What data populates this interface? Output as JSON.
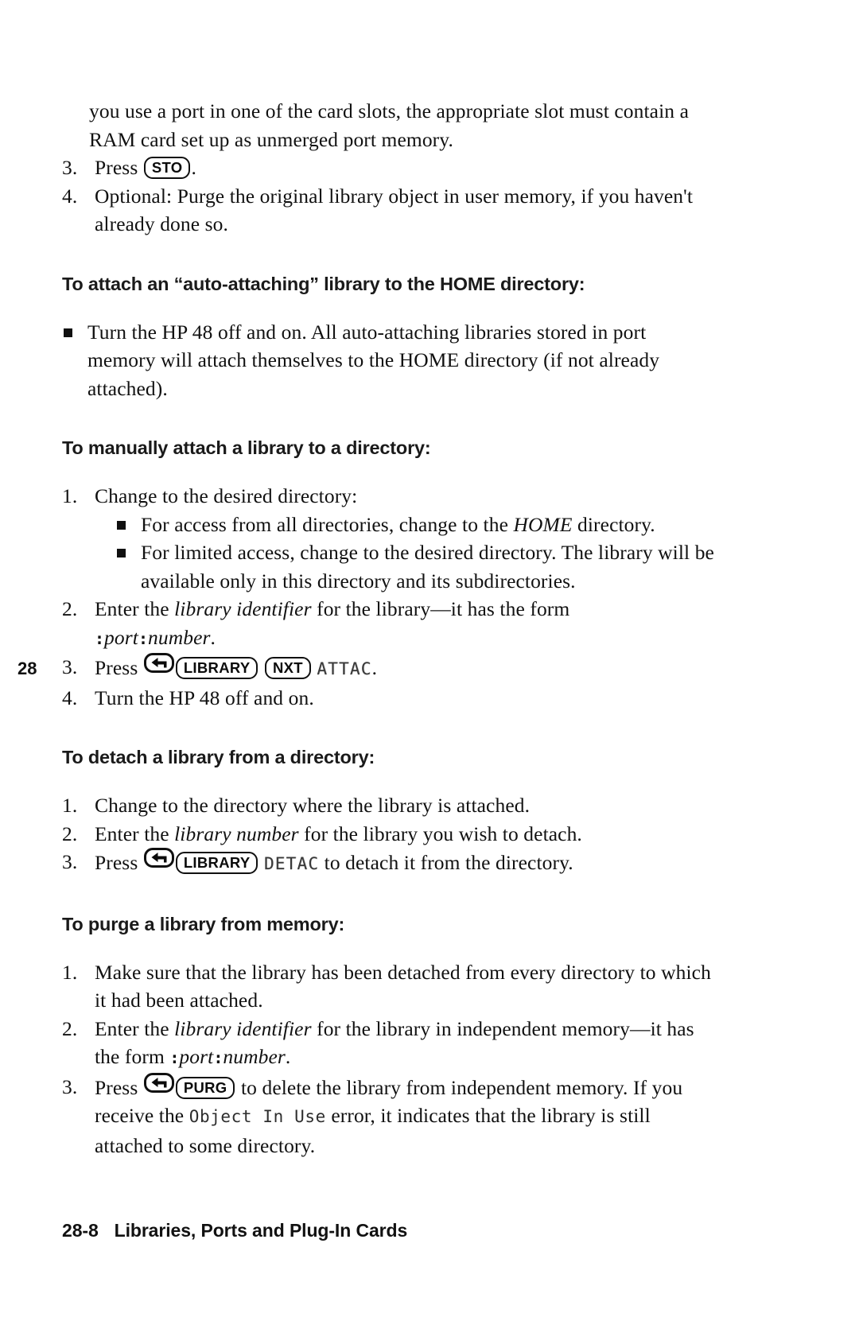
{
  "page": {
    "margin_tab": "28",
    "footer_page_number": "28-8",
    "footer_title": "Libraries, Ports and Plug-In Cards"
  },
  "intro": {
    "continued_text": "you use a port in one of the card slots, the appropriate slot must contain a RAM card set up as unmerged port memory.",
    "steps": [
      {
        "number": "3.",
        "lead": "Press",
        "key": "STO",
        "trail": "."
      },
      {
        "number": "4.",
        "text": "Optional: Purge the original library object in user memory, if you haven't already done so."
      }
    ]
  },
  "sections": [
    {
      "heading": "To attach an “auto-attaching” library to the HOME directory:",
      "bullets": [
        "Turn the HP 48 off and on. All auto-attaching libraries stored in port memory will attach themselves to the HOME directory (if not already attached)."
      ]
    },
    {
      "heading": "To manually attach a library to a directory:",
      "steps": [
        {
          "number": "1.",
          "text": "Change to the desired directory:",
          "subbullets": [
            {
              "pre": "For access from all directories, change to the ",
              "italic": "HOME",
              "post": " directory."
            },
            {
              "pre": "For limited access, change to the desired directory. The library will be available only in this directory and its subdirectories.",
              "italic": "",
              "post": ""
            }
          ]
        },
        {
          "number": "2.",
          "pre": "Enter the ",
          "italic": "library identifier",
          "post": " for the library—it has the form",
          "form_prefix": ":",
          "form_port": "port",
          "form_colon": ":",
          "form_number": "number",
          "form_suffix": "."
        },
        {
          "number": "3.",
          "lead": "Press",
          "keys": [
            "shift-left",
            "LIBRARY",
            "NXT"
          ],
          "menu_label": "ATTAC",
          "trail": "."
        },
        {
          "number": "4.",
          "text": "Turn the HP 48 off and on."
        }
      ]
    },
    {
      "heading": "To detach a library from a directory:",
      "steps": [
        {
          "number": "1.",
          "text": "Change to the directory where the library is attached."
        },
        {
          "number": "2.",
          "pre": "Enter the ",
          "italic": "library number",
          "post": " for the library you wish to detach."
        },
        {
          "number": "3.",
          "lead": "Press",
          "keys": [
            "shift-left",
            "LIBRARY"
          ],
          "menu_label": "DETAC",
          "trail": " to detach it from the directory."
        }
      ]
    },
    {
      "heading": "To purge a library from memory:",
      "steps": [
        {
          "number": "1.",
          "text": "Make sure that the library has been detached from every directory to which it had been attached."
        },
        {
          "number": "2.",
          "pre": "Enter the ",
          "italic": "library identifier",
          "post": " for the library in independent memory—it has the form ",
          "form_prefix": ":",
          "form_port": "port",
          "form_colon": ":",
          "form_number": "number",
          "form_suffix": "."
        },
        {
          "number": "3.",
          "lead": "Press",
          "keys": [
            "shift-left",
            "PURG"
          ],
          "mid_text": " to delete the library from independent memory. If you receive the ",
          "error_text": "Object In Use",
          "tail_text": " error, it indicates that the library is still attached to some directory."
        }
      ]
    }
  ],
  "keys": {
    "sto": "STO",
    "library": "LIBRARY",
    "nxt": "NXT",
    "purg": "PURG"
  }
}
